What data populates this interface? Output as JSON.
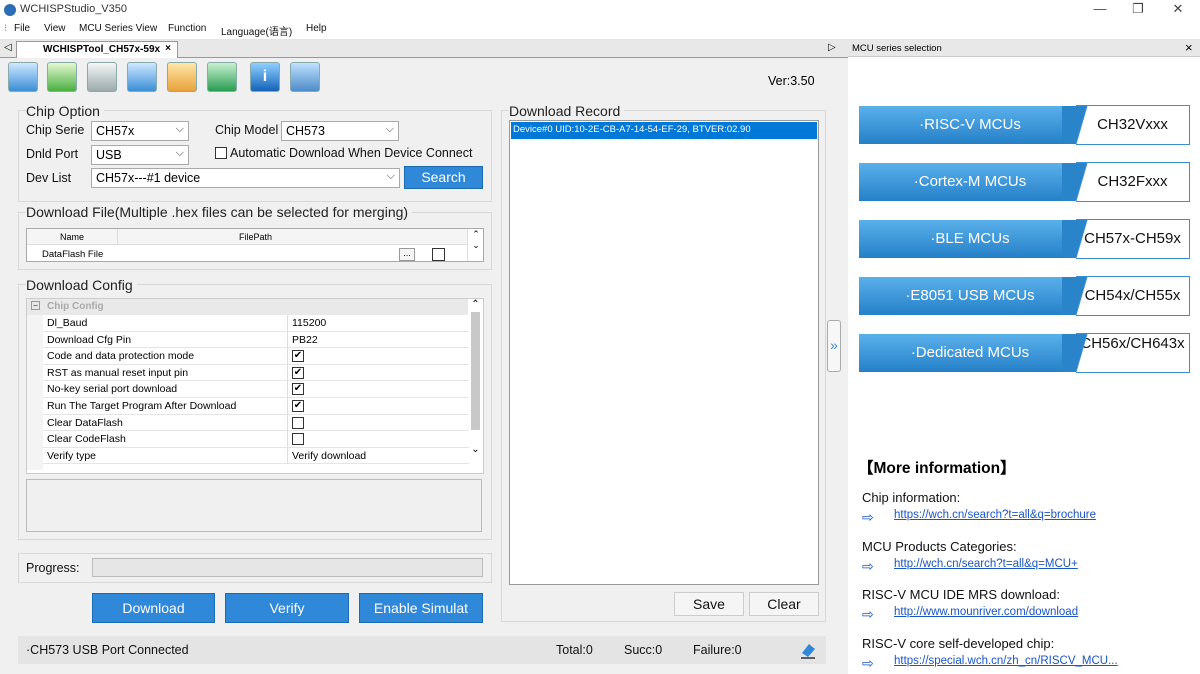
{
  "window": {
    "title": "WCHISPStudio_V350"
  },
  "menu": [
    "File",
    "View",
    "MCU Series View",
    "Function",
    "Language(语言)",
    "Help"
  ],
  "tab": {
    "label": "WCHISPTool_CH57x-59x",
    "close": "×"
  },
  "toolbar": {
    "version": "Ver:3.50"
  },
  "chip_option": {
    "title": "Chip Option",
    "chip_serie_label": "Chip Serie",
    "chip_serie_value": "CH57x",
    "chip_model_label": "Chip Model",
    "chip_model_value": "CH573",
    "dnld_port_label": "Dnld Port",
    "dnld_port_value": "USB",
    "auto_download_label": "Automatic Download When Device Connect",
    "dev_list_label": "Dev List",
    "dev_list_value": "CH57x---#1 device",
    "search_label": "Search"
  },
  "download_file": {
    "title": "Download File(Multiple .hex files can be selected for merging)",
    "headers": [
      "Name",
      "FilePath"
    ],
    "row_name": "DataFlash File",
    "browse": "..."
  },
  "download_config": {
    "title": "Download Config",
    "group": "Chip Config",
    "rows": [
      {
        "name": "Dl_Baud",
        "value": "115200",
        "type": "text"
      },
      {
        "name": "Download Cfg Pin",
        "value": "PB22",
        "type": "text"
      },
      {
        "name": "Code and data protection mode",
        "value": "✔",
        "type": "check"
      },
      {
        "name": "RST as manual reset input pin",
        "value": "✔",
        "type": "check"
      },
      {
        "name": "No-key serial port download",
        "value": "✔",
        "type": "check"
      },
      {
        "name": "Run The Target Program After Download",
        "value": "✔",
        "type": "check"
      },
      {
        "name": "Clear DataFlash",
        "value": "",
        "type": "check"
      },
      {
        "name": "Clear CodeFlash",
        "value": "",
        "type": "check"
      },
      {
        "name": "Verify type",
        "value": "Verify download",
        "type": "text"
      }
    ]
  },
  "progress": {
    "label": "Progress:",
    "value": 0
  },
  "buttons": {
    "download": "Download",
    "verify": "Verify",
    "simulate": "Enable Simulat",
    "save": "Save",
    "clear": "Clear"
  },
  "record": {
    "title": "Download Record",
    "entry": "Device#0  UID:10-2E-CB-A7-14-54-EF-29, BTVER:02.90"
  },
  "status": {
    "connection": "·CH573  USB Port  Connected",
    "total": "Total:0",
    "succ": "Succ:0",
    "failure": "Failure:0"
  },
  "expander": "»",
  "right_pane": {
    "title": "MCU series selection",
    "close": "×",
    "series": [
      {
        "name": "·RISC-V MCUs",
        "chips": "CH32Vxxx"
      },
      {
        "name": "·Cortex-M MCUs",
        "chips": "CH32Fxxx"
      },
      {
        "name": "·BLE MCUs",
        "chips": "CH57x-CH59x"
      },
      {
        "name": "·E8051 USB MCUs",
        "chips": "CH54x/CH55x"
      },
      {
        "name": "·Dedicated MCUs",
        "chips": "CH56x/CH643x"
      }
    ],
    "more_title": "【More information】",
    "info": [
      {
        "label": "Chip information:",
        "link": "https://wch.cn/search?t=all&q=brochure"
      },
      {
        "label": "MCU Products Categories:",
        "link": "http://wch.cn/search?t=all&q=MCU+"
      },
      {
        "label": "RISC-V MCU IDE MRS download:",
        "link": "http://www.mounriver.com/download"
      },
      {
        "label": "RISC-V core self-developed chip:",
        "link": "https://special.wch.cn/zh_cn/RISCV_MCU..."
      }
    ]
  }
}
